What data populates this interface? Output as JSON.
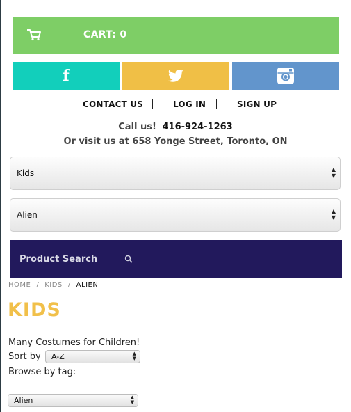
{
  "cart": {
    "label": "CART: 0",
    "icon": "cart-icon",
    "color": "#7ece66"
  },
  "social": [
    {
      "name": "facebook",
      "icon": "facebook-icon",
      "glyph": "f",
      "color": "#12cfbb"
    },
    {
      "name": "twitter",
      "icon": "twitter-icon",
      "color": "#f0bf46"
    },
    {
      "name": "instagram",
      "icon": "instagram-icon",
      "color": "#6295cc"
    }
  ],
  "nav": {
    "contact": "CONTACT US",
    "login": "LOG IN",
    "signup": "SIGN UP"
  },
  "contact": {
    "call_prefix": "Call us!",
    "phone": "416-924-1263",
    "visit": "Or visit us at 658 Yonge Street, Toronto, ON"
  },
  "category_select": {
    "value": "Kids"
  },
  "subcategory_select": {
    "value": "Alien"
  },
  "search": {
    "placeholder": "Product Search",
    "icon": "search-icon",
    "background": "#22195c"
  },
  "breadcrumb": {
    "home": "HOME",
    "kids": "KIDS",
    "current": "ALIEN",
    "separator": "/"
  },
  "page": {
    "title": "KIDS",
    "title_color": "#f1c04a",
    "description": "Many Costumes for Children!",
    "sort_label": "Sort by",
    "sort_value": "A-Z",
    "browse_label": "Browse by tag:",
    "tag_value": "Alien"
  }
}
